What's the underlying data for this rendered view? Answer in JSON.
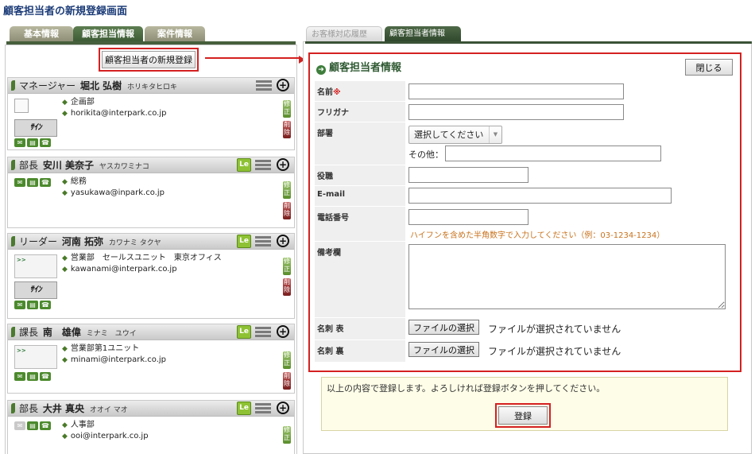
{
  "page_title": "顧客担当者の新規登録画面",
  "left_tabs": [
    {
      "label": "基本情報",
      "active": false
    },
    {
      "label": "顧客担当情報",
      "active": true
    },
    {
      "label": "案件情報",
      "active": false
    }
  ],
  "new_button_label": "顧客担当者の新規登録",
  "contacts": [
    {
      "title": "マネージャー",
      "name": "堀北 弘樹",
      "kana": "ホリキタヒロキ",
      "dept": "企画部",
      "email": "horikita@interpark.co.jp"
    },
    {
      "title": "部長",
      "name": "安川 美奈子",
      "kana": "ヤスカワミナコ",
      "dept": "総務",
      "email": "yasukawa@inpark.co.jp"
    },
    {
      "title": "リーダー",
      "name": "河南 拓弥",
      "kana": "カワナミ タクヤ",
      "dept": "営業部　セールスユニット　東京オフィス",
      "email": "kawanami@interpark.co.jp"
    },
    {
      "title": "課長",
      "name": "南　雄偉",
      "kana": "ミナミ　ユウイ",
      "dept": "営業部第1ユニット",
      "email": "minami@interpark.co.jp"
    },
    {
      "title": "部長",
      "name": "大井 真央",
      "kana": "オオイ マオ",
      "dept": "人事部",
      "email": "ooi@interpark.co.jp"
    }
  ],
  "card_icons": {
    "le": "Le",
    "edit": "修正",
    "delete": "削除",
    "sign": "ｻｲﾝ"
  },
  "right_tabs": [
    {
      "label": "お客様対応履歴",
      "active": false
    },
    {
      "label": "顧客担当者情報",
      "active": true,
      "close": "x"
    }
  ],
  "form": {
    "title": "顧客担当者情報",
    "close_label": "閉じる",
    "name_label": "名前",
    "required_mark": "※",
    "furigana_label": "フリガナ",
    "dept_label": "部署",
    "dept_select": "選択してください",
    "other_label": "その他：",
    "position_label": "役職",
    "email_label": "E-mail",
    "phone_label": "電話番号",
    "phone_hint": "ハイフンを含めた半角数字で入力してください（例：03-1234-1234）",
    "notes_label": "備考欄",
    "card_front_label": "名刺 表",
    "card_back_label": "名刺 裏",
    "file_button": "ファイルの選択",
    "file_status": "ファイルが選択されていません"
  },
  "confirm": {
    "text": "以上の内容で登録します。よろしければ登録ボタンを押してください。",
    "button": "登録"
  }
}
